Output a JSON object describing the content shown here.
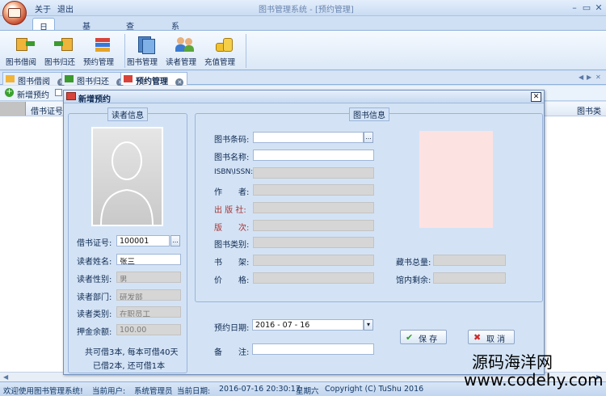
{
  "window": {
    "title": "图书管理系统 - [预约管理]",
    "menu_about": "关于",
    "menu_exit": "退出"
  },
  "ribbon": {
    "tabs": [
      "日常操作",
      "基础设置",
      "查询统计",
      "系统设置"
    ],
    "buttons": [
      "图书借阅",
      "图书归还",
      "预约管理",
      "图书管理",
      "读者管理",
      "充值管理"
    ]
  },
  "doc_tabs": [
    "图书借阅",
    "图书归还",
    "预约管理"
  ],
  "toolbar": {
    "new_label": "新增预约"
  },
  "grid": {
    "col1": "借书证号",
    "col_right": "图书类别"
  },
  "dialog": {
    "title": "新增预约",
    "reader_group": "读者信息",
    "book_group": "图书信息",
    "reader": {
      "card_label": "借书证号:",
      "card_value": "100001",
      "name_label": "读者姓名:",
      "name_value": "张三",
      "gender_label": "读者性别:",
      "gender_value": "男",
      "dept_label": "读者部门:",
      "dept_value": "研发部",
      "type_label": "读者类别:",
      "type_value": "在职员工",
      "balance_label": "押金余额:",
      "balance_value": "100.00",
      "info_line1": "共可借3本, 每本可借40天",
      "info_line2": "已借2本, 还可借1本"
    },
    "book": {
      "barcode_label": "图书条码:",
      "title_label": "图书名称:",
      "isbn_label": "ISBN\\ISSN:",
      "author_label": "作　　者:",
      "publisher_label": "出 版 社:",
      "edition_label": "版　　次:",
      "category_label": "图书类别:",
      "shelf_label": "书　　架:",
      "price_label": "价　　格:",
      "total_label": "藏书总量:",
      "remain_label": "馆内剩余:"
    },
    "reserve_date_label": "预约日期:",
    "reserve_date_value": "2016 - 07 - 16",
    "remark_label": "备　　注:",
    "save_label": "保 存",
    "cancel_label": "取 消"
  },
  "status": {
    "welcome": "欢迎使用图书管理系统!",
    "user_label": "当前用户:",
    "user_value": "系统管理员",
    "date_label": "当前日期:",
    "date_value": "2016-07-16 20:30:17",
    "weekday": "星期六",
    "copyright": "Copyright (C) TuShu 2016"
  },
  "watermark": {
    "line1": "源码海洋网",
    "line2": "www.codehy.com"
  }
}
